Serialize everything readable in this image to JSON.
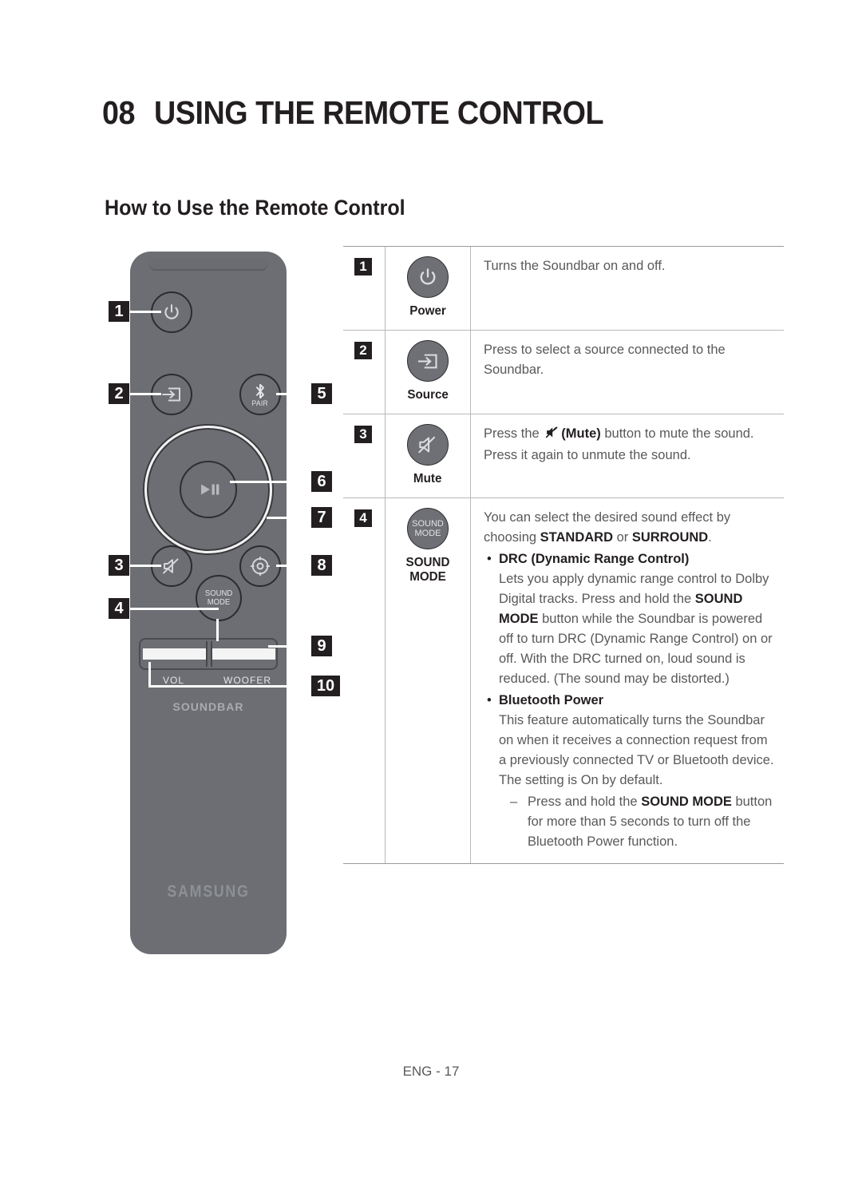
{
  "header": {
    "chapter_number": "08",
    "chapter_title": "USING THE REMOTE CONTROL",
    "section_title": "How to Use the Remote Control"
  },
  "remote": {
    "brand": "SAMSUNG",
    "product_word": "SOUNDBAR",
    "pair_label": "PAIR",
    "sound_mode_line1": "SOUND",
    "sound_mode_line2": "MODE",
    "vol_label": "VOL",
    "woofer_label": "WOOFER",
    "callouts": [
      {
        "id": "1",
        "target": "power-button"
      },
      {
        "id": "2",
        "target": "source-button"
      },
      {
        "id": "3",
        "target": "mute-button"
      },
      {
        "id": "4",
        "target": "sound-mode-button"
      },
      {
        "id": "5",
        "target": "bluetooth-pair-button"
      },
      {
        "id": "6",
        "target": "play-pause-button"
      },
      {
        "id": "7",
        "target": "navigation-wheel"
      },
      {
        "id": "8",
        "target": "settings-button"
      },
      {
        "id": "9",
        "target": "woofer-rocker"
      },
      {
        "id": "10",
        "target": "volume-rocker"
      }
    ]
  },
  "table": {
    "rows": [
      {
        "number": "1",
        "button_label": "Power",
        "icon": "power-icon",
        "description": "Turns the Soundbar on and off."
      },
      {
        "number": "2",
        "button_label": "Source",
        "icon": "source-input-icon",
        "description": "Press to select a source connected to the Soundbar."
      },
      {
        "number": "3",
        "button_label": "Mute",
        "icon": "mute-icon",
        "desc_part1": "Press the",
        "desc_bold": "(Mute)",
        "desc_part2": "button to mute the sound. Press it again to unmute the sound."
      },
      {
        "number": "4",
        "button_label": "SOUND MODE",
        "icon": "sound-mode-icon",
        "intro_part1": "You can select the desired sound effect by choosing",
        "intro_bold1": "STANDARD",
        "intro_mid": "or",
        "intro_bold2": "SURROUND",
        "intro_end": ".",
        "bullets": [
          {
            "head": "DRC (Dynamic Range Control)",
            "body_part1": "Lets you apply dynamic range control to Dolby Digital tracks. Press and hold the",
            "body_bold": "SOUND MODE",
            "body_part2": "button while the Soundbar is powered off to turn DRC (Dynamic Range Control) on or off. With the DRC turned on, loud sound is reduced. (The sound may be distorted.)"
          },
          {
            "head": "Bluetooth Power",
            "body_part1": "This feature automatically turns the Soundbar on when it receives a connection request from a previously connected TV or Bluetooth device. The setting is On by default.",
            "sub_part1": "Press and hold the",
            "sub_bold": "SOUND MODE",
            "sub_part2": "button for more than 5 seconds to turn off the Bluetooth Power function."
          }
        ]
      }
    ]
  },
  "footer": {
    "page_label": "ENG - 17"
  }
}
